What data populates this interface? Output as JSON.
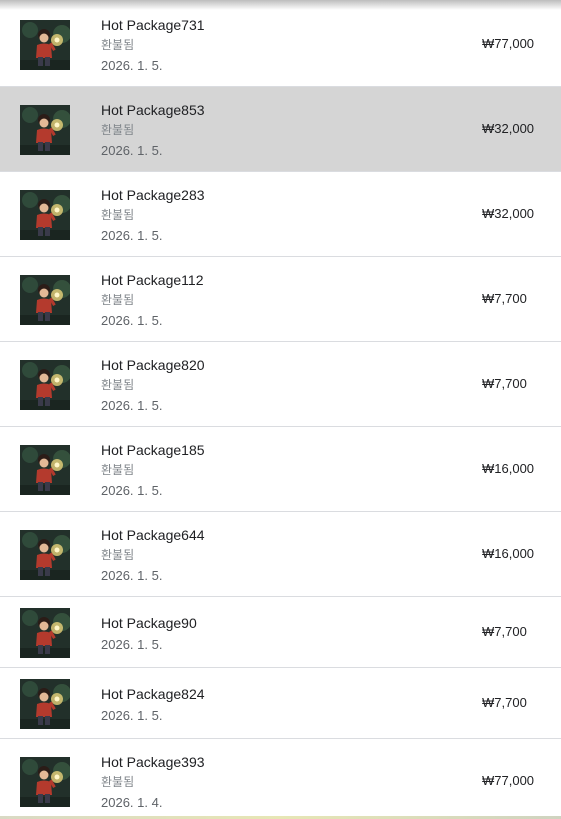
{
  "purchases": [
    {
      "title": "Hot Package731",
      "status": "환불됨",
      "date": "2026. 1. 5.",
      "price": "₩77,000"
    },
    {
      "title": "Hot Package853",
      "status": "환불됨",
      "date": "2026. 1. 5.",
      "price": "₩32,000"
    },
    {
      "title": "Hot Package283",
      "status": "환불됨",
      "date": "2026. 1. 5.",
      "price": "₩32,000"
    },
    {
      "title": "Hot Package112",
      "status": "환불됨",
      "date": "2026. 1. 5.",
      "price": "₩7,700"
    },
    {
      "title": "Hot Package820",
      "status": "환불됨",
      "date": "2026. 1. 5.",
      "price": "₩7,700"
    },
    {
      "title": "Hot Package185",
      "status": "환불됨",
      "date": "2026. 1. 5.",
      "price": "₩16,000"
    },
    {
      "title": "Hot Package644",
      "status": "환불됨",
      "date": "2026. 1. 5.",
      "price": "₩16,000"
    },
    {
      "title": "Hot Package90",
      "date": "2026. 1. 5.",
      "price": "₩7,700"
    },
    {
      "title": "Hot Package824",
      "date": "2026. 1. 5.",
      "price": "₩7,700"
    },
    {
      "title": "Hot Package393",
      "status": "환불됨",
      "date": "2026. 1. 4.",
      "price": "₩77,000"
    }
  ],
  "icons": {
    "thumbnail": "game-character-thumbnail-icon"
  },
  "colors": {
    "selected_row": "#d5d5d5",
    "divider": "#dadce0",
    "status_text": "#80868b"
  }
}
